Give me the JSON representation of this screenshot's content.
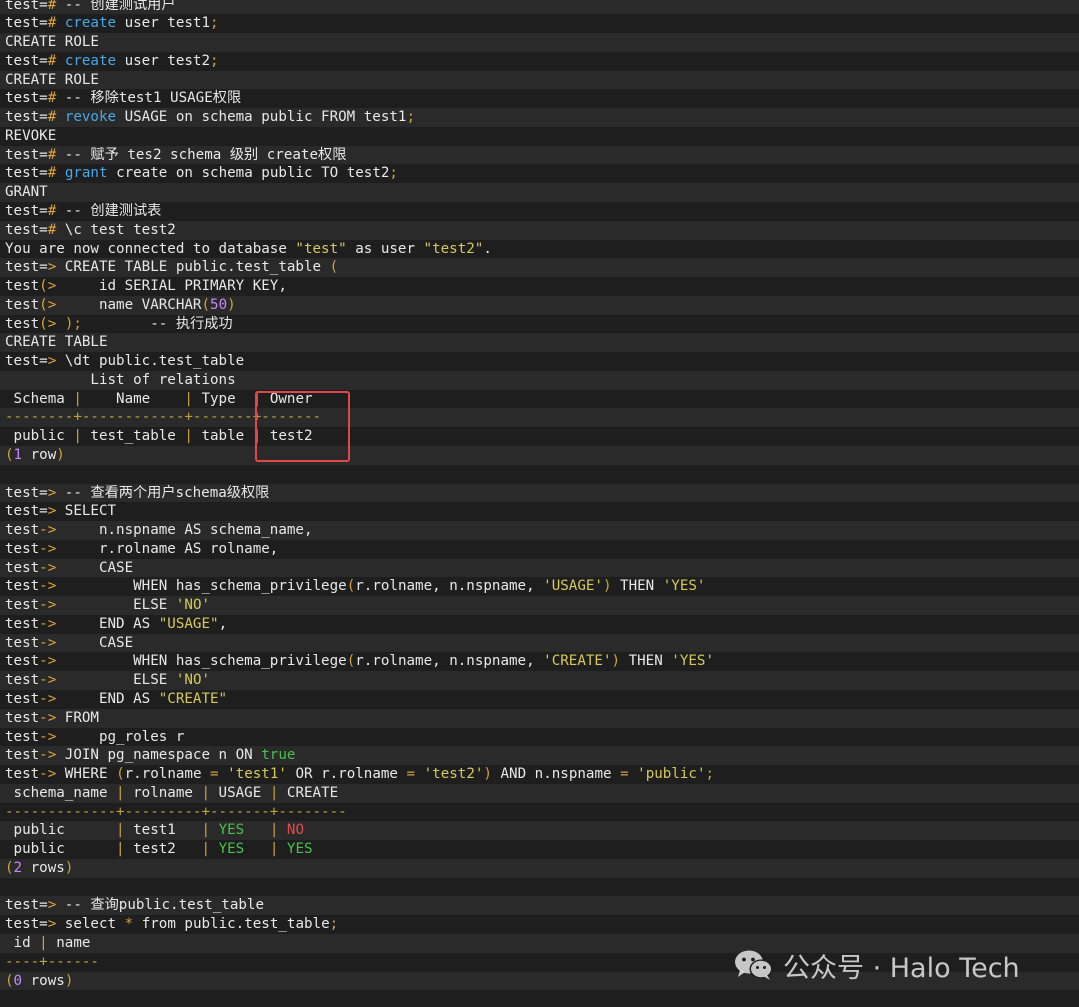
{
  "terminal": {
    "lines": [
      [
        [
          "prompt",
          "test="
        ],
        [
          "op",
          "#"
        ],
        [
          "plain",
          " -- 创建测试用户"
        ]
      ],
      [
        [
          "prompt",
          "test="
        ],
        [
          "op",
          "#"
        ],
        [
          "plain",
          " "
        ],
        [
          "kw",
          "create"
        ],
        [
          "plain",
          " user test1"
        ],
        [
          "sep",
          ";"
        ]
      ],
      [
        [
          "plain",
          "CREATE ROLE"
        ]
      ],
      [
        [
          "prompt",
          "test="
        ],
        [
          "op",
          "#"
        ],
        [
          "plain",
          " "
        ],
        [
          "kw",
          "create"
        ],
        [
          "plain",
          " user test2"
        ],
        [
          "sep",
          ";"
        ]
      ],
      [
        [
          "plain",
          "CREATE ROLE"
        ]
      ],
      [
        [
          "prompt",
          "test="
        ],
        [
          "op",
          "#"
        ],
        [
          "plain",
          " -- 移除test1 USAGE权限"
        ]
      ],
      [
        [
          "prompt",
          "test="
        ],
        [
          "op",
          "#"
        ],
        [
          "plain",
          " "
        ],
        [
          "kw",
          "revoke"
        ],
        [
          "plain",
          " USAGE on schema public FROM test1"
        ],
        [
          "sep",
          ";"
        ]
      ],
      [
        [
          "plain",
          "REVOKE"
        ]
      ],
      [
        [
          "prompt",
          "test="
        ],
        [
          "op",
          "#"
        ],
        [
          "plain",
          " -- 赋予 tes2 schema 级别 create权限"
        ]
      ],
      [
        [
          "prompt",
          "test="
        ],
        [
          "op",
          "#"
        ],
        [
          "plain",
          " "
        ],
        [
          "kw",
          "grant"
        ],
        [
          "plain",
          " create on schema public TO test2"
        ],
        [
          "sep",
          ";"
        ]
      ],
      [
        [
          "plain",
          "GRANT"
        ]
      ],
      [
        [
          "prompt",
          "test="
        ],
        [
          "op",
          "#"
        ],
        [
          "plain",
          " -- 创建测试表"
        ]
      ],
      [
        [
          "prompt",
          "test="
        ],
        [
          "op",
          "#"
        ],
        [
          "plain",
          " \\c test test2"
        ]
      ],
      [
        [
          "plain",
          "You are now connected to database "
        ],
        [
          "str",
          "\"test\""
        ],
        [
          "plain",
          " as user "
        ],
        [
          "str",
          "\"test2\""
        ],
        [
          "plain",
          "."
        ]
      ],
      [
        [
          "prompt",
          "test="
        ],
        [
          "op",
          ">"
        ],
        [
          "plain",
          " CREATE TABLE public.test_table "
        ],
        [
          "sep",
          "("
        ]
      ],
      [
        [
          "prompt",
          "test"
        ],
        [
          "op",
          "(>"
        ],
        [
          "plain",
          "     id SERIAL PRIMARY KEY,"
        ]
      ],
      [
        [
          "prompt",
          "test"
        ],
        [
          "op",
          "(>"
        ],
        [
          "plain",
          "     name VARCHAR"
        ],
        [
          "sep",
          "("
        ],
        [
          "num",
          "50"
        ],
        [
          "sep",
          ")"
        ]
      ],
      [
        [
          "prompt",
          "test"
        ],
        [
          "op",
          "(>"
        ],
        [
          "plain",
          " "
        ],
        [
          "sep",
          ");"
        ],
        [
          "plain",
          "        -- 执行成功"
        ]
      ],
      [
        [
          "plain",
          "CREATE TABLE"
        ]
      ],
      [
        [
          "prompt",
          "test="
        ],
        [
          "op",
          ">"
        ],
        [
          "plain",
          " \\dt public.test_table"
        ]
      ],
      [
        [
          "plain",
          "          List of relations"
        ]
      ],
      [
        [
          "plain",
          " Schema "
        ],
        [
          "sep",
          "|"
        ],
        [
          "plain",
          "    Name    "
        ],
        [
          "sep",
          "|"
        ],
        [
          "plain",
          " Type  "
        ],
        [
          "sep",
          "|"
        ],
        [
          "plain",
          " Owner"
        ]
      ],
      [
        [
          "dash",
          "--------+------------+-------+-------"
        ]
      ],
      [
        [
          "plain",
          " public "
        ],
        [
          "sep",
          "|"
        ],
        [
          "plain",
          " test_table "
        ],
        [
          "sep",
          "|"
        ],
        [
          "plain",
          " table "
        ],
        [
          "sep",
          "|"
        ],
        [
          "plain",
          " test2"
        ]
      ],
      [
        [
          "sep",
          "("
        ],
        [
          "num",
          "1"
        ],
        [
          "plain",
          " row"
        ],
        [
          "sep",
          ")"
        ]
      ],
      [],
      [
        [
          "prompt",
          "test="
        ],
        [
          "op",
          ">"
        ],
        [
          "plain",
          " -- 查看两个用户schema级权限"
        ]
      ],
      [
        [
          "prompt",
          "test="
        ],
        [
          "op",
          ">"
        ],
        [
          "plain",
          " SELECT"
        ]
      ],
      [
        [
          "prompt",
          "test"
        ],
        [
          "op",
          "->"
        ],
        [
          "plain",
          "     n.nspname AS schema_name,"
        ]
      ],
      [
        [
          "prompt",
          "test"
        ],
        [
          "op",
          "->"
        ],
        [
          "plain",
          "     r.rolname AS rolname,"
        ]
      ],
      [
        [
          "prompt",
          "test"
        ],
        [
          "op",
          "->"
        ],
        [
          "plain",
          "     CASE"
        ]
      ],
      [
        [
          "prompt",
          "test"
        ],
        [
          "op",
          "->"
        ],
        [
          "plain",
          "         WHEN has_schema_privilege"
        ],
        [
          "sep",
          "("
        ],
        [
          "plain",
          "r.rolname, n.nspname, "
        ],
        [
          "str",
          "'USAGE'"
        ],
        [
          "sep",
          ")"
        ],
        [
          "plain",
          " THEN "
        ],
        [
          "str",
          "'YES'"
        ]
      ],
      [
        [
          "prompt",
          "test"
        ],
        [
          "op",
          "->"
        ],
        [
          "plain",
          "         ELSE "
        ],
        [
          "str",
          "'NO'"
        ]
      ],
      [
        [
          "prompt",
          "test"
        ],
        [
          "op",
          "->"
        ],
        [
          "plain",
          "     END AS "
        ],
        [
          "str",
          "\"USAGE\""
        ],
        [
          "plain",
          ","
        ]
      ],
      [
        [
          "prompt",
          "test"
        ],
        [
          "op",
          "->"
        ],
        [
          "plain",
          "     CASE"
        ]
      ],
      [
        [
          "prompt",
          "test"
        ],
        [
          "op",
          "->"
        ],
        [
          "plain",
          "         WHEN has_schema_privilege"
        ],
        [
          "sep",
          "("
        ],
        [
          "plain",
          "r.rolname, n.nspname, "
        ],
        [
          "str",
          "'CREATE'"
        ],
        [
          "sep",
          ")"
        ],
        [
          "plain",
          " THEN "
        ],
        [
          "str",
          "'YES'"
        ]
      ],
      [
        [
          "prompt",
          "test"
        ],
        [
          "op",
          "->"
        ],
        [
          "plain",
          "         ELSE "
        ],
        [
          "str",
          "'NO'"
        ]
      ],
      [
        [
          "prompt",
          "test"
        ],
        [
          "op",
          "->"
        ],
        [
          "plain",
          "     END AS "
        ],
        [
          "str",
          "\"CREATE\""
        ]
      ],
      [
        [
          "prompt",
          "test"
        ],
        [
          "op",
          "->"
        ],
        [
          "plain",
          " FROM"
        ]
      ],
      [
        [
          "prompt",
          "test"
        ],
        [
          "op",
          "->"
        ],
        [
          "plain",
          "     pg_roles r"
        ]
      ],
      [
        [
          "prompt",
          "test"
        ],
        [
          "op",
          "->"
        ],
        [
          "plain",
          " JOIN pg_namespace n ON "
        ],
        [
          "yes",
          "true"
        ]
      ],
      [
        [
          "prompt",
          "test"
        ],
        [
          "op",
          "->"
        ],
        [
          "plain",
          " WHERE "
        ],
        [
          "sep",
          "("
        ],
        [
          "plain",
          "r.rolname "
        ],
        [
          "sep",
          "="
        ],
        [
          "plain",
          " "
        ],
        [
          "str",
          "'test1'"
        ],
        [
          "plain",
          " OR r.rolname "
        ],
        [
          "sep",
          "="
        ],
        [
          "plain",
          " "
        ],
        [
          "str",
          "'test2'"
        ],
        [
          "sep",
          ")"
        ],
        [
          "plain",
          " AND n.nspname "
        ],
        [
          "sep",
          "="
        ],
        [
          "plain",
          " "
        ],
        [
          "str",
          "'public'"
        ],
        [
          "sep",
          ";"
        ]
      ],
      [
        [
          "plain",
          " schema_name "
        ],
        [
          "sep",
          "|"
        ],
        [
          "plain",
          " rolname "
        ],
        [
          "sep",
          "|"
        ],
        [
          "plain",
          " USAGE "
        ],
        [
          "sep",
          "|"
        ],
        [
          "plain",
          " CREATE"
        ]
      ],
      [
        [
          "dash",
          "-------------+---------+-------+--------"
        ]
      ],
      [
        [
          "plain",
          " public      "
        ],
        [
          "sep",
          "|"
        ],
        [
          "plain",
          " test1   "
        ],
        [
          "sep",
          "|"
        ],
        [
          "plain",
          " "
        ],
        [
          "yes",
          "YES"
        ],
        [
          "plain",
          "   "
        ],
        [
          "sep",
          "|"
        ],
        [
          "plain",
          " "
        ],
        [
          "no",
          "NO"
        ]
      ],
      [
        [
          "plain",
          " public      "
        ],
        [
          "sep",
          "|"
        ],
        [
          "plain",
          " test2   "
        ],
        [
          "sep",
          "|"
        ],
        [
          "plain",
          " "
        ],
        [
          "yes",
          "YES"
        ],
        [
          "plain",
          "   "
        ],
        [
          "sep",
          "|"
        ],
        [
          "plain",
          " "
        ],
        [
          "yes",
          "YES"
        ]
      ],
      [
        [
          "sep",
          "("
        ],
        [
          "num",
          "2"
        ],
        [
          "plain",
          " rows"
        ],
        [
          "sep",
          ")"
        ]
      ],
      [],
      [
        [
          "prompt",
          "test="
        ],
        [
          "op",
          ">"
        ],
        [
          "plain",
          " -- 查询public.test_table"
        ]
      ],
      [
        [
          "prompt",
          "test="
        ],
        [
          "op",
          ">"
        ],
        [
          "plain",
          " select "
        ],
        [
          "sep",
          "*"
        ],
        [
          "plain",
          " from public.test_table"
        ],
        [
          "sep",
          ";"
        ]
      ],
      [
        [
          "plain",
          " id "
        ],
        [
          "sep",
          "|"
        ],
        [
          "plain",
          " name"
        ]
      ],
      [
        [
          "dash",
          "----+------"
        ]
      ],
      [
        [
          "sep",
          "("
        ],
        [
          "num",
          "0"
        ],
        [
          "plain",
          " rows"
        ],
        [
          "sep",
          ")"
        ]
      ]
    ]
  },
  "watermark": {
    "text": "公众号 · Halo Tech",
    "icon": "wechat-icon"
  },
  "colors": {
    "background": "#1e1e1e",
    "stripe": "#2a2a2a",
    "keyword": "#46a8e6",
    "operator": "#e2a33a",
    "string": "#d8c85a",
    "number": "#c58af9",
    "yes": "#47c24b",
    "no": "#e24b4b",
    "highlight": "#e04848"
  }
}
